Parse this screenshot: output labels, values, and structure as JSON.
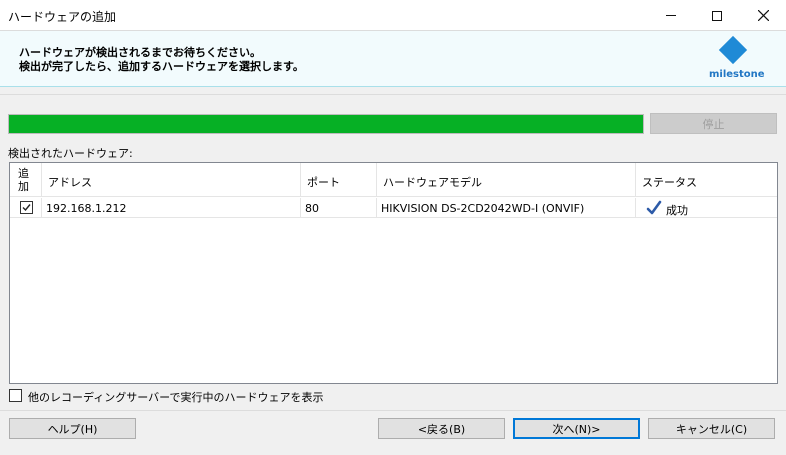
{
  "window": {
    "title": "ハードウェアの追加",
    "controls": [
      "minimize-icon",
      "maximize-icon",
      "close-icon"
    ]
  },
  "header": {
    "line1": "ハードウェアが検出されるまでお待ちください。",
    "line2": "検出が完了したら、追加するハードウェアを選択します。",
    "logo_text": "milestone",
    "logo_color": "#1f8ad6"
  },
  "progress": {
    "value_percent": 100,
    "color": "#06b025",
    "stop_label": "停止"
  },
  "found_label": "検出されたハードウェア:",
  "table": {
    "columns": {
      "add": "追加",
      "address": "アドレス",
      "port": "ポート",
      "model": "ハードウェアモデル",
      "status": "ステータス"
    },
    "rows": [
      {
        "checked": true,
        "address": "192.168.1.212",
        "port": "80",
        "model": "HIKVISION DS-2CD2042WD-I (ONVIF)",
        "status": "成功",
        "status_icon": "checkmark-icon"
      }
    ]
  },
  "show_other": {
    "checked": false,
    "label": "他のレコーディングサーバーで実行中のハードウェアを表示"
  },
  "buttons": {
    "help": "ヘルプ(H)",
    "back": "<戻る(B)",
    "next": "次へ(N)>",
    "cancel": "キャンセル(C)"
  }
}
